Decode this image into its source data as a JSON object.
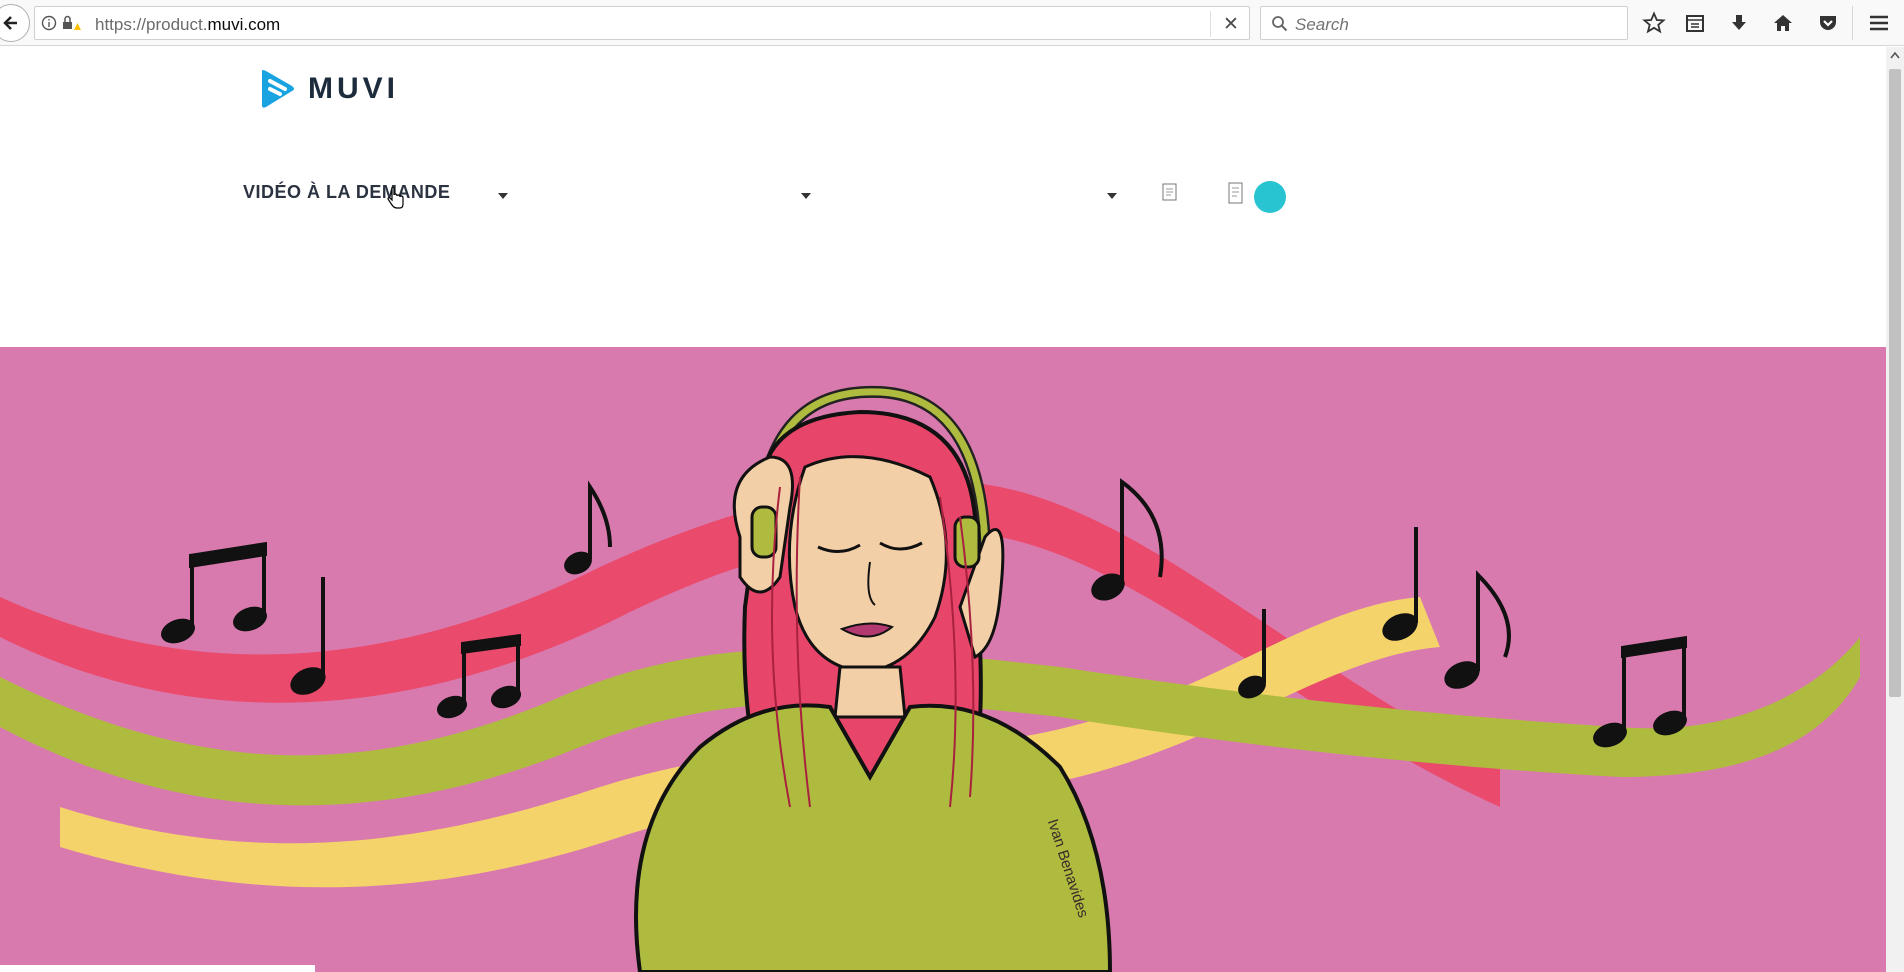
{
  "browser": {
    "url_prefix": "https://product.",
    "url_host": "muvi.com",
    "search_placeholder": "Search",
    "clear_glyph": "✕"
  },
  "site": {
    "logo_text": "MUVI",
    "nav": [
      {
        "label": "VIDÉO À LA DEMANDE"
      }
    ],
    "avatar_color": "#29c4d1"
  },
  "banner": {
    "background_color": "#d97aaf",
    "signature": "Ivan Benavides"
  },
  "icons": [
    "back-arrow-icon",
    "info-icon",
    "lock-warning-icon",
    "search-icon",
    "bookmark-star-icon",
    "reading-list-icon",
    "download-icon",
    "home-icon",
    "pocket-icon",
    "hamburger-menu-icon",
    "caret-down-icon",
    "mouse-cursor-icon"
  ]
}
